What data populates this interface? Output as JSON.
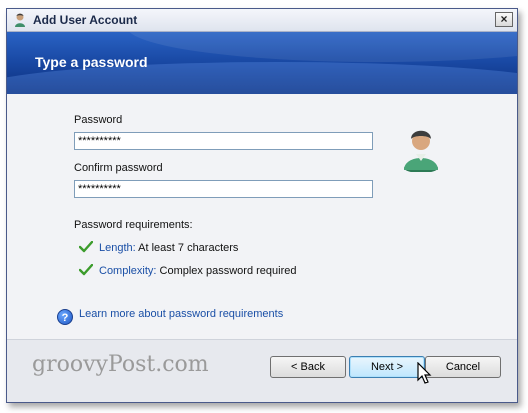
{
  "window": {
    "title": "Add User Account",
    "close_glyph": "×"
  },
  "banner": {
    "heading": "Type a password"
  },
  "form": {
    "password_label": "Password",
    "password_value": "**********",
    "confirm_label": "Confirm password",
    "confirm_value": "**********"
  },
  "requirements": {
    "heading": "Password requirements:",
    "items": [
      {
        "key": "Length:",
        "text": " At least 7 characters",
        "icon": "green-check-icon"
      },
      {
        "key": "Complexity:",
        "text": " Complex password required",
        "icon": "green-check-icon"
      }
    ]
  },
  "help": {
    "icon": "help-icon",
    "icon_glyph": "?",
    "link_text": "Learn more about password requirements"
  },
  "footer": {
    "watermark": "groovyPost.com",
    "back_label": "< Back",
    "next_label": "Next >",
    "cancel_label": "Cancel"
  },
  "colors": {
    "banner": "#1a4aa6",
    "link": "#1a4fa6",
    "check": "#3c9c2c"
  }
}
